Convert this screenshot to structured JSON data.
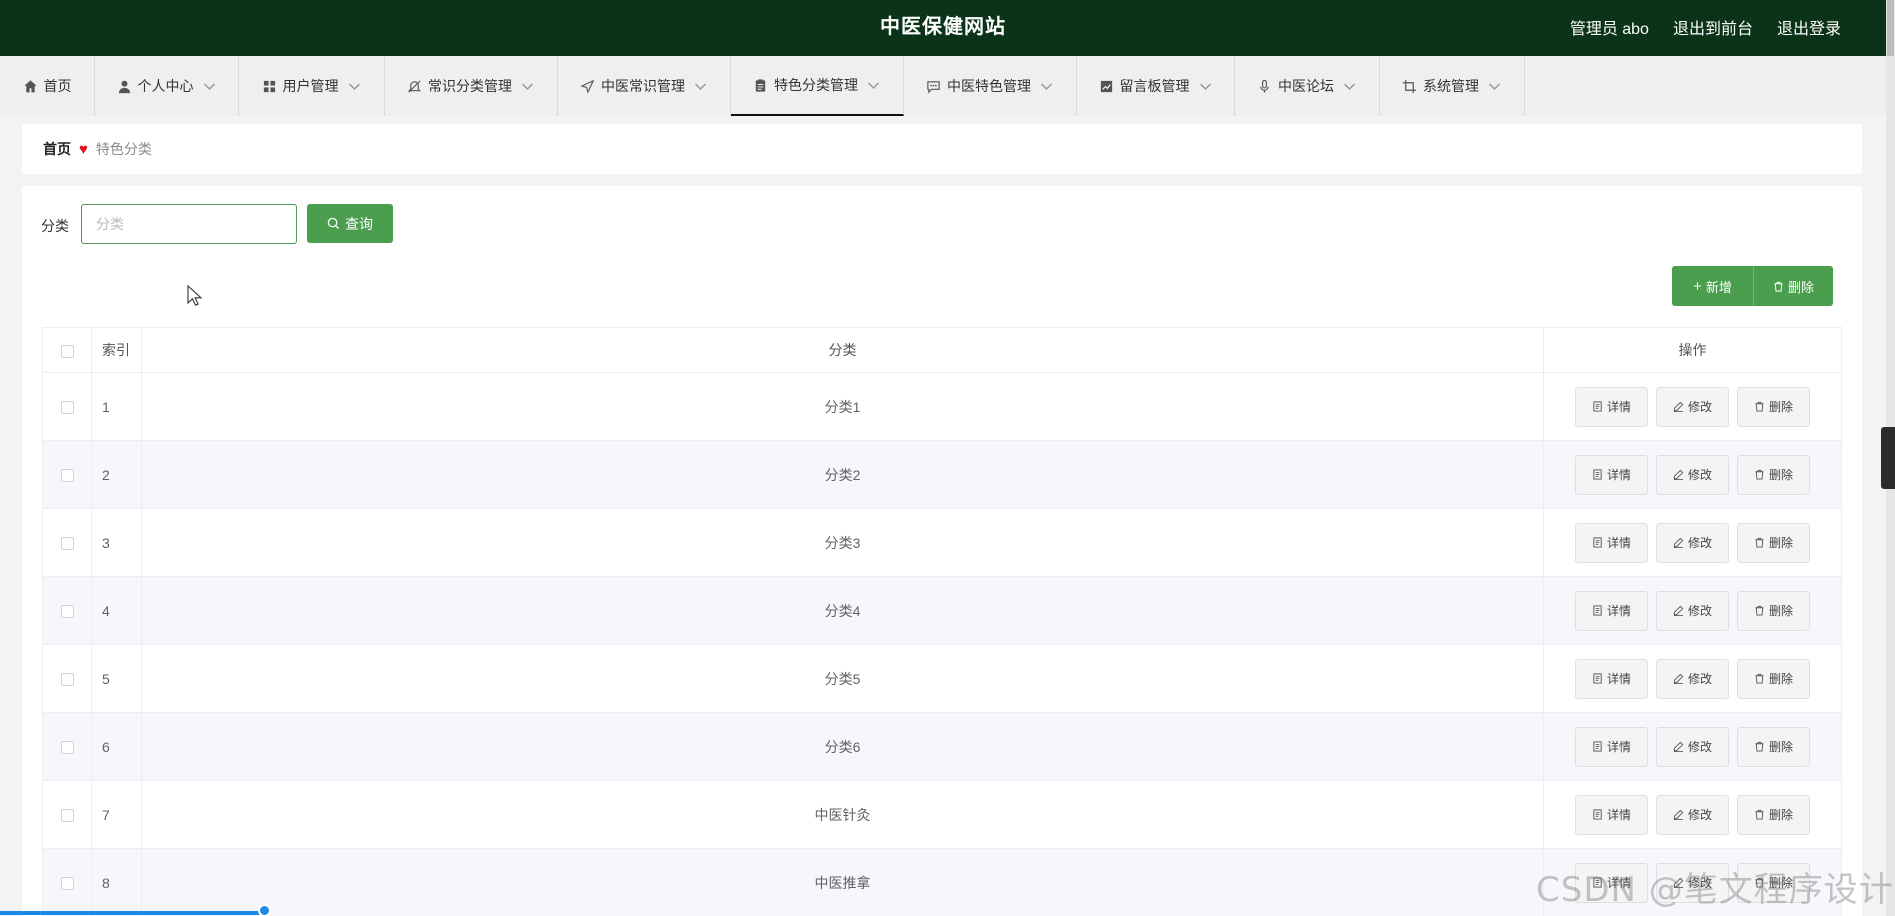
{
  "header": {
    "site_title": "中医保健网站",
    "admin_label": "管理员 abo",
    "back_to_front": "退出到前台",
    "logout": "退出登录"
  },
  "nav": {
    "items": [
      {
        "label": "首页",
        "icon": "home-icon"
      },
      {
        "label": "个人中心",
        "icon": "user-icon"
      },
      {
        "label": "用户管理",
        "icon": "grid-icon"
      },
      {
        "label": "常识分类管理",
        "icon": "bell-off-icon"
      },
      {
        "label": "中医常识管理",
        "icon": "send-icon"
      },
      {
        "label": "特色分类管理",
        "icon": "clipboard-icon"
      },
      {
        "label": "中医特色管理",
        "icon": "chat-icon"
      },
      {
        "label": "留言板管理",
        "icon": "chart-icon"
      },
      {
        "label": "中医论坛",
        "icon": "microphone-icon"
      },
      {
        "label": "系统管理",
        "icon": "crop-icon"
      }
    ],
    "active": "特色分类管理"
  },
  "breadcrumb": {
    "home": "首页",
    "current": "特色分类"
  },
  "search": {
    "label": "分类",
    "placeholder": "分类",
    "value": "",
    "button": "查询"
  },
  "actions": {
    "add": "新增",
    "delete": "删除"
  },
  "table": {
    "headers": {
      "index": "索引",
      "category": "分类",
      "operations": "操作"
    },
    "row_buttons": {
      "detail": "详情",
      "edit": "修改",
      "delete": "删除"
    },
    "rows": [
      {
        "index": "1",
        "category": "分类1"
      },
      {
        "index": "2",
        "category": "分类2"
      },
      {
        "index": "3",
        "category": "分类3"
      },
      {
        "index": "4",
        "category": "分类4"
      },
      {
        "index": "5",
        "category": "分类5"
      },
      {
        "index": "6",
        "category": "分类6"
      },
      {
        "index": "7",
        "category": "中医针灸"
      },
      {
        "index": "8",
        "category": "中医推拿"
      }
    ]
  },
  "page_progress": 0.14,
  "watermark": "CSDN @笔文程序设计",
  "colors": {
    "header_bg": "#0b3317",
    "primary_green": "#4a9e4e",
    "heart_red": "#e0121f",
    "progress_blue": "#1e88e5"
  }
}
